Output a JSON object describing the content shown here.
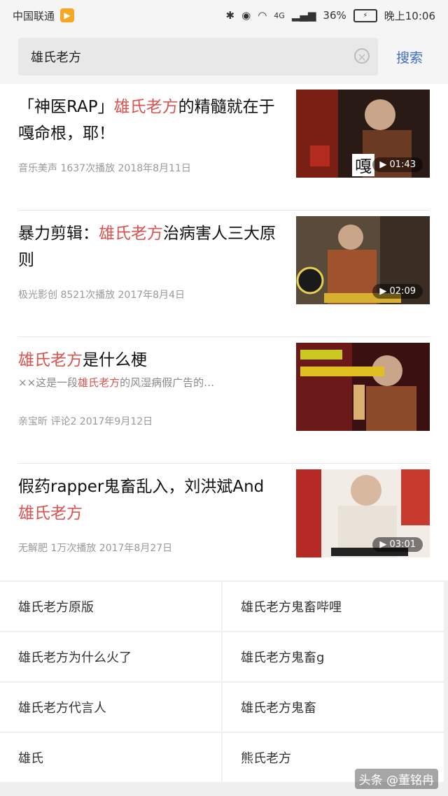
{
  "status_bar": {
    "carrier": "中国联通",
    "network": "4G",
    "battery": "36%",
    "time": "晚上10:06"
  },
  "search": {
    "query": "雄氏老方",
    "button_label": "搜索"
  },
  "results": [
    {
      "title_pre": "「神医RAP」",
      "title_hl": "雄氏老方",
      "title_post": "的精髓就在于嘎命根，耶！",
      "meta": "音乐美声 1637次播放 2018年8月11日",
      "duration": "01:43"
    },
    {
      "title_pre": "暴力剪辑：",
      "title_hl": "雄氏老方",
      "title_post": "治病害人三大原则",
      "meta": "极光影创 8521次播放 2017年8月4日",
      "duration": "02:09"
    },
    {
      "title_pre": "",
      "title_hl": "雄氏老方",
      "title_post": "是什么梗",
      "sub_pre": "××这是一段",
      "sub_hl": "雄氏老方",
      "sub_post": "的风湿病假广告的…",
      "meta": "亲宝昕 评论2 2017年9月12日",
      "duration": ""
    },
    {
      "title_pre": "假药rapper鬼畜乱入，刘洪斌And",
      "title_hl": "雄氏老方",
      "title_post": "",
      "meta": "无解肥 1万次播放 2017年8月27日",
      "duration": "03:01"
    }
  ],
  "suggestions": [
    "雄氏老方原版",
    "雄氏老方鬼畜哔哩",
    "雄氏老方为什么火了",
    "雄氏老方鬼畜g",
    "雄氏老方代言人",
    "雄氏老方鬼畜",
    "雄氏",
    "熊氏老方"
  ],
  "watermark": "头条 @董铭冉"
}
